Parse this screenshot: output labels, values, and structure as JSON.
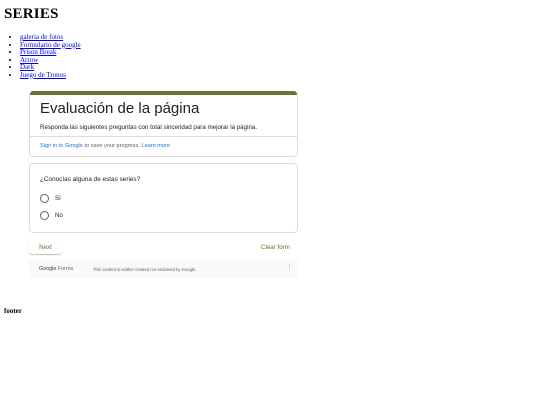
{
  "site": {
    "title": "SERIES",
    "nav": [
      "galeria de fotos",
      "Formulario de google",
      "Prison Break",
      "Arrow",
      "Dark",
      "Juego de Tronos"
    ],
    "footer": "footer"
  },
  "form": {
    "accent_color": "#6b7431",
    "title": "Evaluación de la página",
    "description": "Responda las siguientes preguntas con total sinceridad para  mejorar la página.",
    "signin_link": "Sign in to Google",
    "signin_rest": " to save your progress. ",
    "learn_more": "Learn more",
    "question": "¿Conocías alguna de estas series?",
    "options": [
      "Sí",
      "No"
    ],
    "next_label": "Next",
    "clear_label": "Clear form"
  },
  "gforms_footer": {
    "logo_google": "Google",
    "logo_forms": " Forms",
    "note": "This content is neither created nor endorsed by Google.",
    "more_icon": "vertical-dots-icon"
  }
}
